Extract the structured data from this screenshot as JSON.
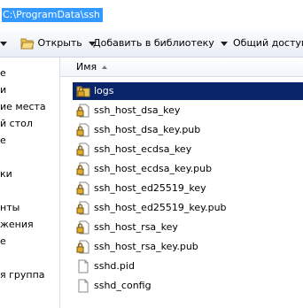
{
  "address_bar": {
    "path": "C:\\ProgramData\\ssh"
  },
  "toolbar": {
    "open_label": "Открыть",
    "add_to_library_label": "Добавить в библиотеку",
    "share_label": "Общий доступ"
  },
  "nav_pane": {
    "items": [
      "е",
      "и",
      "ие места",
      "й стол",
      "е",
      "ки",
      "нты",
      "жения",
      "е",
      "я группа"
    ]
  },
  "file_list": {
    "column_name": "Имя",
    "files": [
      {
        "name": "logs",
        "icon": "folder-lock-icon",
        "selected": true
      },
      {
        "name": "ssh_host_dsa_key",
        "icon": "file-lock-icon",
        "selected": false
      },
      {
        "name": "ssh_host_dsa_key.pub",
        "icon": "file-lock-icon",
        "selected": false
      },
      {
        "name": "ssh_host_ecdsa_key",
        "icon": "file-lock-icon",
        "selected": false
      },
      {
        "name": "ssh_host_ecdsa_key.pub",
        "icon": "file-lock-icon",
        "selected": false
      },
      {
        "name": "ssh_host_ed25519_key",
        "icon": "file-lock-icon",
        "selected": false
      },
      {
        "name": "ssh_host_ed25519_key.pub",
        "icon": "file-lock-icon",
        "selected": false
      },
      {
        "name": "ssh_host_rsa_key",
        "icon": "file-lock-icon",
        "selected": false
      },
      {
        "name": "ssh_host_rsa_key.pub",
        "icon": "file-lock-icon",
        "selected": false
      },
      {
        "name": "sshd.pid",
        "icon": "file-icon",
        "selected": false
      },
      {
        "name": "sshd_config",
        "icon": "file-icon",
        "selected": false
      }
    ]
  },
  "colors": {
    "selection": "#0a246a",
    "address_highlight": "#3399ff",
    "toolbar_bg": "#e9eef5"
  }
}
